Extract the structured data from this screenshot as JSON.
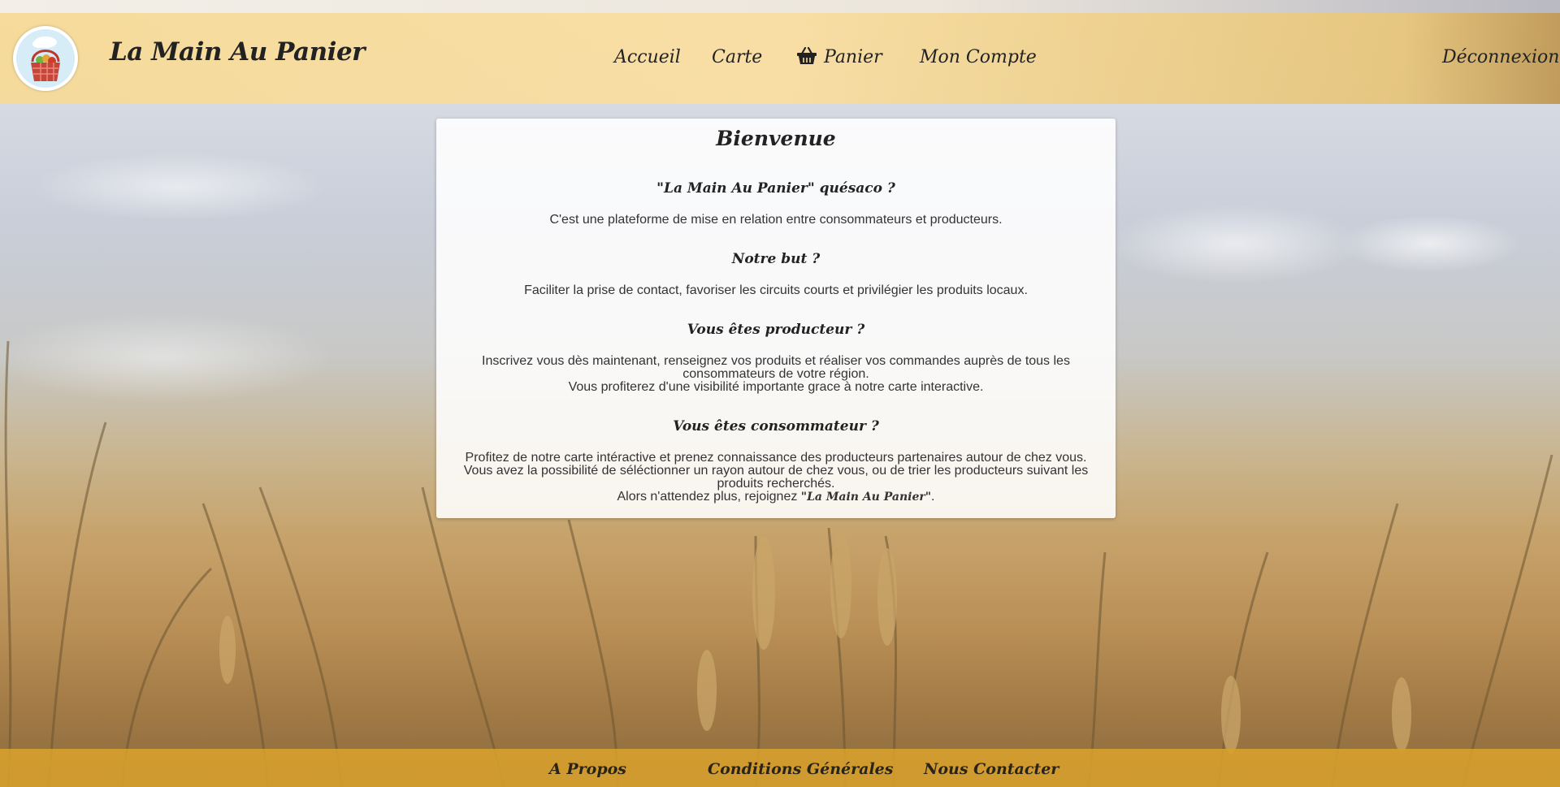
{
  "brand": {
    "name": "La Main Au Panier"
  },
  "nav": {
    "home": "Accueil",
    "map": "Carte",
    "cart": "Panier",
    "account": "Mon Compte",
    "logout": "Déconnexion"
  },
  "welcome": {
    "title": "Bienvenue",
    "sections": [
      {
        "heading": "\"La Main Au Panier\" quésaco ?",
        "lines": [
          "C'est une plateforme de mise en relation entre consommateurs et producteurs."
        ]
      },
      {
        "heading": "Notre but ?",
        "lines": [
          "Faciliter la prise de contact, favoriser les circuits courts et privilégier les produits locaux."
        ]
      },
      {
        "heading": "Vous êtes producteur ?",
        "lines": [
          "Inscrivez vous dès maintenant, renseignez vos produits et réaliser vos commandes auprès de tous les consommateurs de votre région.",
          "Vous profiterez d'une visibilité importante grace à notre carte interactive."
        ]
      },
      {
        "heading": "Vous êtes consommateur ?",
        "lines": [
          "Profitez de notre carte intéractive et prenez connaissance des producteurs partenaires autour de chez vous.",
          "Vous avez la possibilité de séléctionner un rayon autour de chez vous, ou de trier les producteurs suivant les produits recherchés."
        ],
        "closing_prefix": "Alors n'attendez plus, rejoignez ",
        "closing_brand": "\"La Main Au Panier\"",
        "closing_suffix": "."
      }
    ]
  },
  "footer": {
    "about": "A Propos",
    "terms": "Conditions Générales",
    "contact": "Nous Contacter"
  },
  "icons": {
    "logo": "basket-logo-icon",
    "cart": "basket-icon"
  },
  "colors": {
    "header_bg": "#f9dc9c",
    "footer_bg": "#d8a02c",
    "card_bg": "#ffffff",
    "text": "#222222"
  }
}
